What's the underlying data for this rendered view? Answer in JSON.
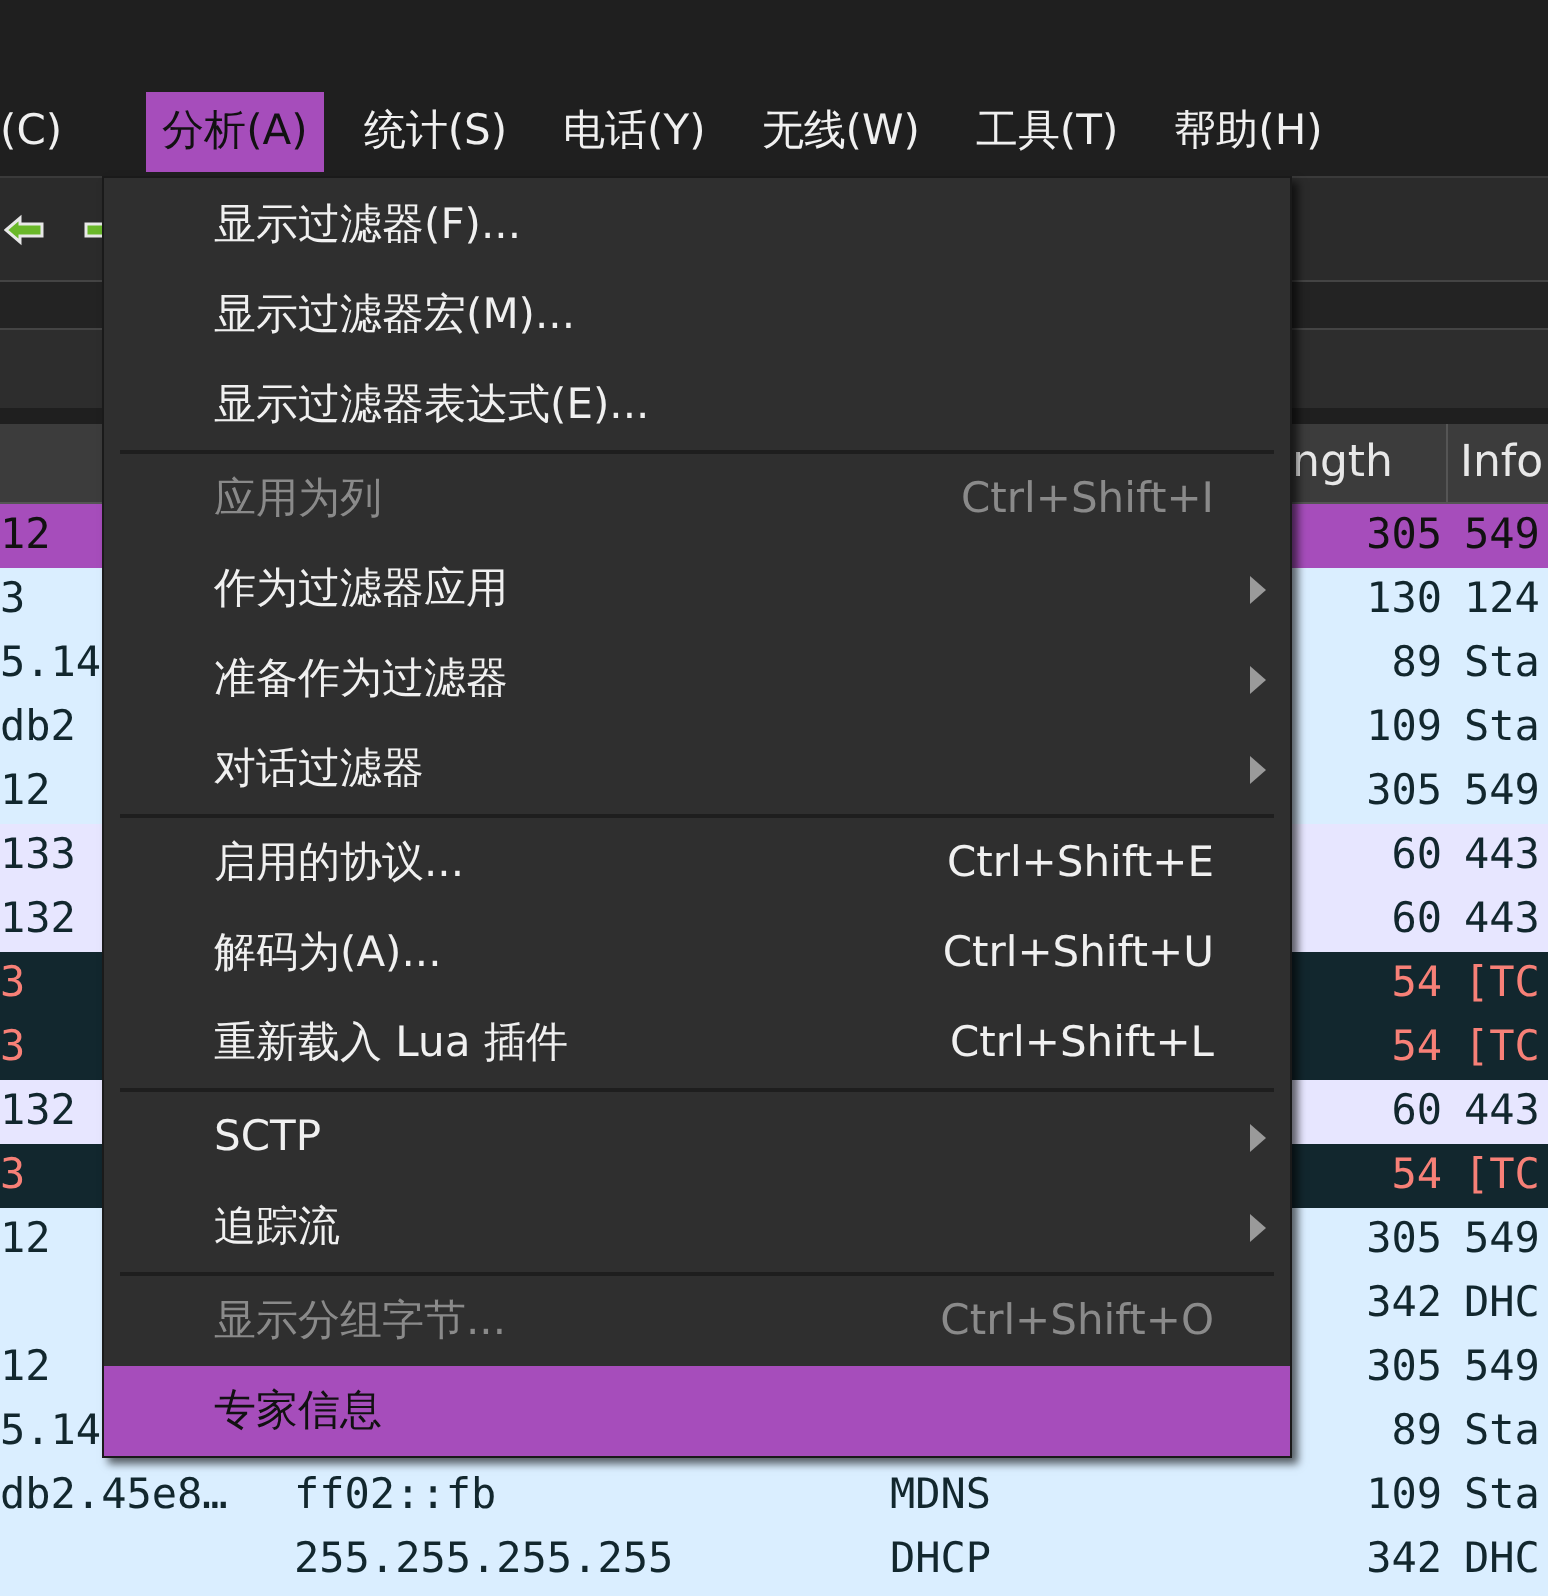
{
  "menubar": [
    {
      "label": "(C)",
      "selected": false
    },
    {
      "label": "分析(A)",
      "selected": true
    },
    {
      "label": "统计(S)",
      "selected": false
    },
    {
      "label": "电话(Y)",
      "selected": false
    },
    {
      "label": "无线(W)",
      "selected": false
    },
    {
      "label": "工具(T)",
      "selected": false
    },
    {
      "label": "帮助(H)",
      "selected": false
    }
  ],
  "table": {
    "columns": [
      "ngth",
      "Info"
    ],
    "rows": [
      {
        "kind": "selected",
        "column_1": "12",
        "length": "305",
        "info": "549"
      },
      {
        "kind": "blue",
        "column_1": "3",
        "length": "130",
        "info": "124"
      },
      {
        "kind": "blue",
        "column_1": "5.14",
        "length": "89",
        "info": "Sta"
      },
      {
        "kind": "blue",
        "column_1": "db2",
        "length": "109",
        "info": "Sta"
      },
      {
        "kind": "blue",
        "column_1": "12",
        "length": "305",
        "info": "549"
      },
      {
        "kind": "lavender",
        "column_1": "133",
        "length": "60",
        "info": "443"
      },
      {
        "kind": "lavender",
        "column_1": "132",
        "length": "60",
        "info": "443"
      },
      {
        "kind": "dark",
        "column_1": "3",
        "length": "54",
        "info": "[TC"
      },
      {
        "kind": "dark",
        "column_1": "3",
        "length": "54",
        "info": "[TC"
      },
      {
        "kind": "lavender",
        "column_1": "132",
        "length": "60",
        "info": "443"
      },
      {
        "kind": "dark",
        "column_1": "3",
        "length": "54",
        "info": "[TC"
      },
      {
        "kind": "blue",
        "column_1": "12",
        "length": "305",
        "info": "549"
      },
      {
        "kind": "blue",
        "length": "342",
        "info": "DHC"
      },
      {
        "kind": "blue",
        "column_1": "12",
        "length": "305",
        "info": "549"
      },
      {
        "kind": "blue",
        "column_1": "5.14",
        "length": "89",
        "info": "Sta"
      },
      {
        "kind": "blue",
        "column_1": "db2.45e8…",
        "destination": "ff02::fb",
        "protocol": "MDNS",
        "length": "109",
        "info": "Sta"
      },
      {
        "kind": "blue",
        "destination": "255.255.255.255",
        "protocol": "DHCP",
        "length": "342",
        "info": "DHC"
      }
    ]
  },
  "menu": [
    {
      "kind": "item",
      "label": "显示过滤器(F)...",
      "disabled": false,
      "submenu": false,
      "selected": false
    },
    {
      "kind": "item",
      "label": "显示过滤器宏(M)...",
      "disabled": false,
      "submenu": false,
      "selected": false
    },
    {
      "kind": "item",
      "label": "显示过滤器表达式(E)...",
      "disabled": false,
      "submenu": false,
      "selected": false
    },
    {
      "kind": "separator"
    },
    {
      "kind": "item",
      "label": "应用为列",
      "shortcut": "Ctrl+Shift+I",
      "disabled": true,
      "submenu": false,
      "selected": false
    },
    {
      "kind": "item",
      "label": "作为过滤器应用",
      "disabled": false,
      "submenu": true,
      "selected": false
    },
    {
      "kind": "item",
      "label": "准备作为过滤器",
      "disabled": false,
      "submenu": true,
      "selected": false
    },
    {
      "kind": "item",
      "label": "对话过滤器",
      "disabled": false,
      "submenu": true,
      "selected": false
    },
    {
      "kind": "separator"
    },
    {
      "kind": "item",
      "label": "启用的协议...",
      "shortcut": "Ctrl+Shift+E",
      "disabled": false,
      "submenu": false,
      "selected": false
    },
    {
      "kind": "item",
      "label": "解码为(A)...",
      "shortcut": "Ctrl+Shift+U",
      "disabled": false,
      "submenu": false,
      "selected": false
    },
    {
      "kind": "item",
      "label": "重新载入 Lua 插件",
      "shortcut": "Ctrl+Shift+L",
      "disabled": false,
      "submenu": false,
      "selected": false
    },
    {
      "kind": "separator"
    },
    {
      "kind": "item",
      "label": "SCTP",
      "disabled": false,
      "submenu": true,
      "selected": false
    },
    {
      "kind": "item",
      "label": "追踪流",
      "disabled": false,
      "submenu": true,
      "selected": false
    },
    {
      "kind": "separator"
    },
    {
      "kind": "item",
      "label": "显示分组字节...",
      "shortcut": "Ctrl+Shift+O",
      "disabled": true,
      "submenu": false,
      "selected": false
    },
    {
      "kind": "item",
      "label": "专家信息",
      "disabled": false,
      "submenu": false,
      "selected": true
    }
  ]
}
